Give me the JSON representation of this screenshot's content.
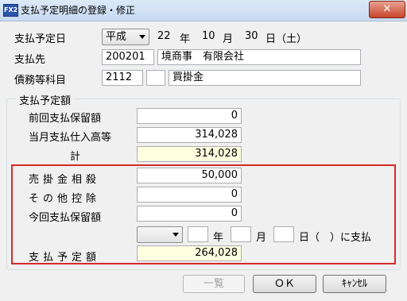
{
  "window": {
    "app_icon": "FX2",
    "title": "支払予定明細の登録・修正",
    "close_label": "✕"
  },
  "form": {
    "date": {
      "label": "支払予定日",
      "era": "平成",
      "year": "22",
      "year_unit": "年",
      "month": "10",
      "month_unit": "月",
      "day": "30",
      "day_suffix": "日（土）"
    },
    "payee": {
      "label": "支払先",
      "code": "200201",
      "name": "境商事　有限会社"
    },
    "account": {
      "label": "債務等科目",
      "code": "2112",
      "sub_code": "",
      "name": "買掛金"
    }
  },
  "group": {
    "title": "支払予定額",
    "prev_hold": {
      "label": "前回支払保留額",
      "value": "0"
    },
    "month_purchase": {
      "label": "当月支払仕入高等",
      "value": "314,028"
    },
    "total": {
      "label": "計",
      "value": "314,028"
    },
    "offset": {
      "label": "売掛金相殺",
      "value": "50,000"
    },
    "other_deduction": {
      "label": "その他控除",
      "value": "0"
    },
    "this_hold": {
      "label": "今回支払保留額",
      "value": "0"
    },
    "pay_date": {
      "era": "",
      "year": "",
      "year_unit": "年",
      "month": "",
      "month_unit": "月",
      "day": "",
      "suffix": "日（　）に支払"
    },
    "scheduled_amount": {
      "label": "支払予定額",
      "value": "264,028"
    }
  },
  "buttons": {
    "list": "一覧",
    "ok": "ＯＫ",
    "cancel": "ｷｬﾝｾﾙ"
  }
}
